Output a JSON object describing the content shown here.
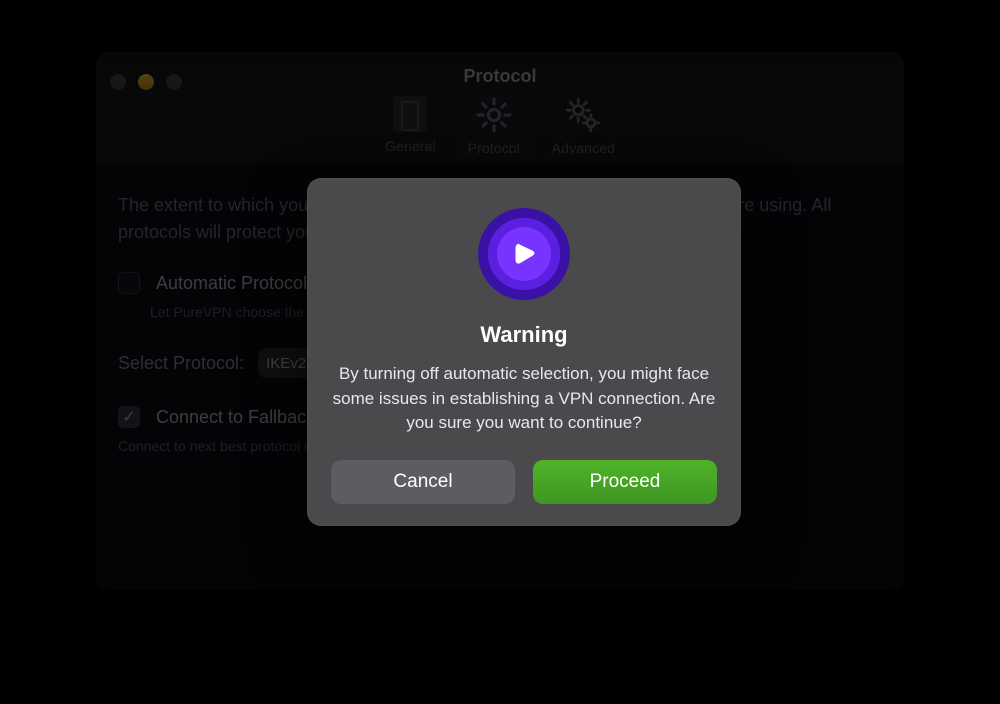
{
  "window": {
    "title": "Protocol"
  },
  "tabs": [
    {
      "id": "general",
      "label": "General"
    },
    {
      "id": "protocol",
      "label": "Protocol"
    },
    {
      "id": "advanced",
      "label": "Advanced"
    }
  ],
  "content": {
    "description": "The extent to which you're protected online depends on the VPN protocol you're using. All protocols will protect your data, change this option when you are sure about it.",
    "auto_label": "Automatic Protocol Selection",
    "auto_sub": "Let PureVPN choose the protocol for you",
    "select_label": "Select Protocol:",
    "select_value": "IKEv2",
    "fallback_label": "Connect to Fallback",
    "fallback_sub": "Connect to next best protocol if unable to connect to preferred protocol"
  },
  "dialog": {
    "title": "Warning",
    "body": "By turning off automatic selection, you might face some issues in establishing a VPN connection. Are you sure you want to continue?",
    "cancel": "Cancel",
    "proceed": "Proceed"
  }
}
